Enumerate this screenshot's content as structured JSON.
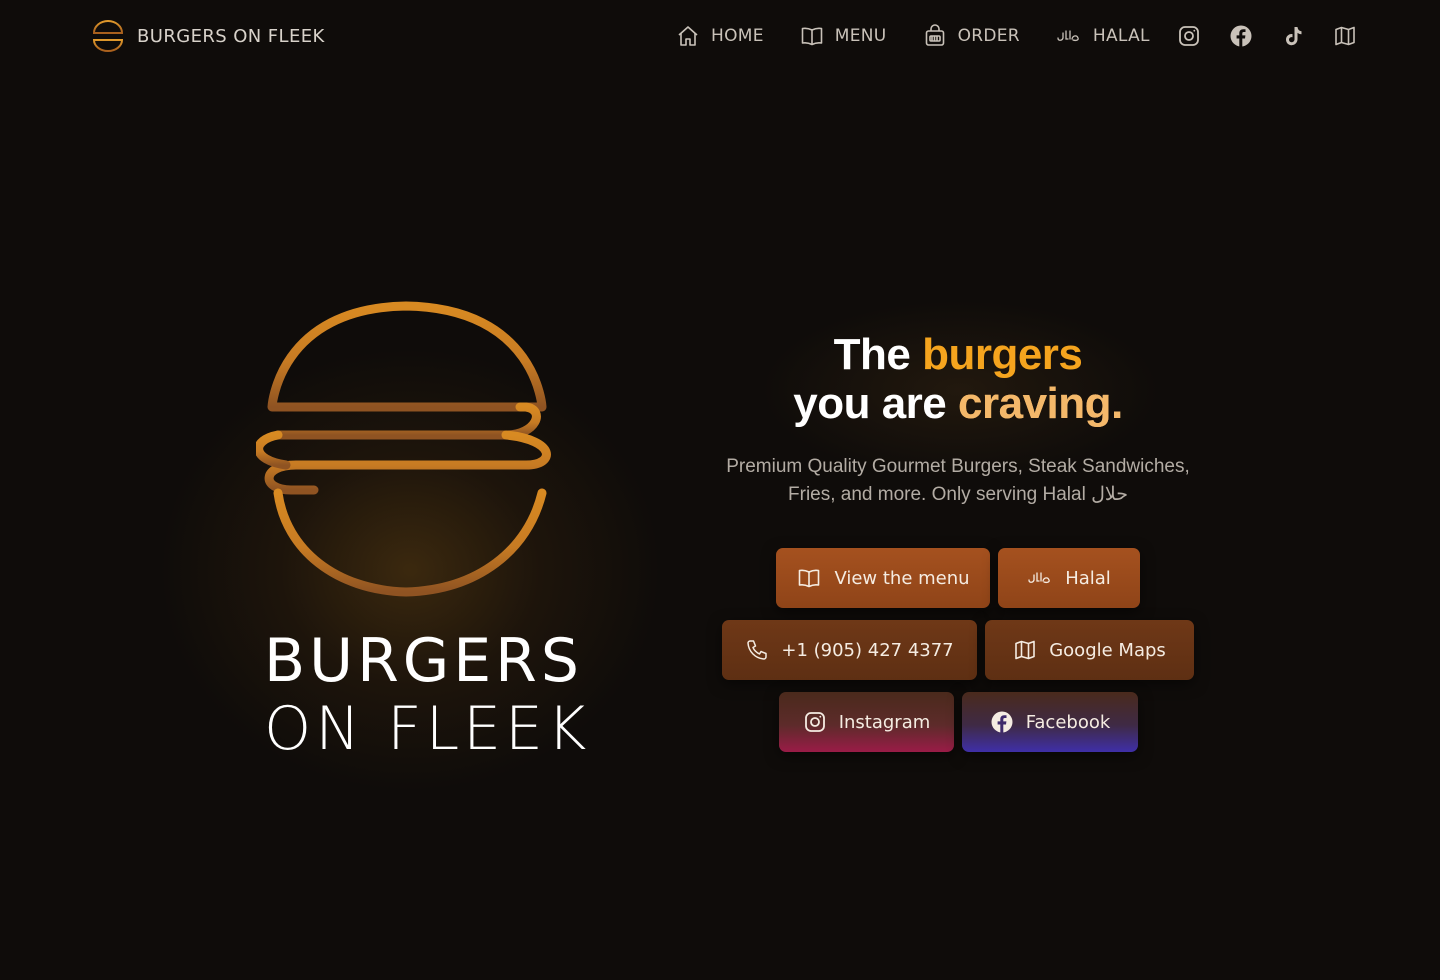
{
  "nav": {
    "brand": "BURGERS ON FLEEK",
    "links": [
      {
        "label": "HOME",
        "icon": "home-icon"
      },
      {
        "label": "MENU",
        "icon": "book-icon"
      },
      {
        "label": "ORDER",
        "icon": "bag-icon"
      },
      {
        "label": "HALAL",
        "icon": "halal-icon"
      }
    ],
    "icon_links": [
      "instagram-icon",
      "facebook-icon",
      "tiktok-icon",
      "map-icon"
    ]
  },
  "hero": {
    "wordmark_line1": "BURGERS",
    "wordmark_line2": "ON FLEEK",
    "headline": {
      "the": "The",
      "burgers": "burgers",
      "you_are": "you are",
      "craving": "craving."
    },
    "subtext": "Premium Quality Gourmet Burgers, Steak Sandwiches, Fries, and more. Only serving Halal حلال"
  },
  "buttons": {
    "menu": "View the menu",
    "halal": "Halal",
    "phone": "+1 (905) 427 4377",
    "maps": "Google Maps",
    "instagram": "Instagram",
    "facebook": "Facebook"
  },
  "colors": {
    "background": "#0f0c0a",
    "accent": "#f5a41e",
    "button_orange": "#a5511f",
    "button_brown": "#6f3817"
  }
}
